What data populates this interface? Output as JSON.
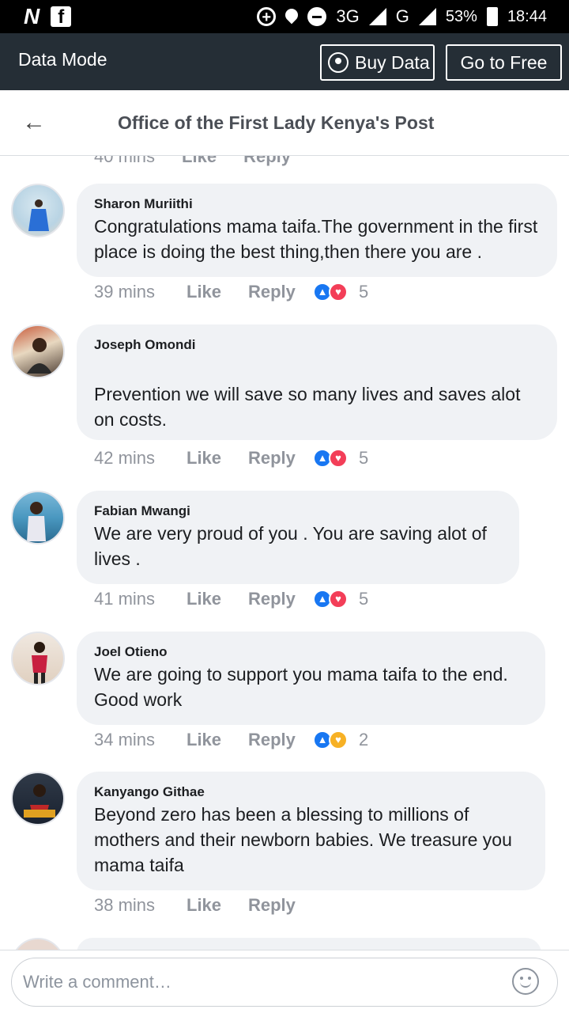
{
  "status_bar": {
    "left_icons": [
      "n-app-icon",
      "facebook-icon"
    ],
    "n_glyph": "N",
    "f_glyph": "f",
    "network": "3G",
    "network2": "G",
    "battery": "53%",
    "time": "18:44"
  },
  "data_bar": {
    "label": "Data Mode",
    "buy_button": "Buy Data",
    "free_button": "Go to Free"
  },
  "header": {
    "back_glyph": "←",
    "title": "Office of the First Lady Kenya's Post"
  },
  "partial_row": {
    "time": "40 mins",
    "like": "Like",
    "reply": "Reply"
  },
  "comments": [
    {
      "name": "Sharon Muriithi",
      "text": "Congratulations mama taifa.The government in the first place is doing the best thing,then there you are .",
      "time": "39 mins",
      "like": "Like",
      "reply": "Reply",
      "reactions": [
        "like",
        "love"
      ],
      "count": "5"
    },
    {
      "name": "Joseph Omondi",
      "text": "Prevention we will save so many lives and saves alot on costs.",
      "time": "42 mins",
      "like": "Like",
      "reply": "Reply",
      "reactions": [
        "like",
        "love"
      ],
      "count": "5"
    },
    {
      "name": "Fabian Mwangi",
      "text": "We are very proud of you . You are saving alot of lives .",
      "time": "41 mins",
      "like": "Like",
      "reply": "Reply",
      "reactions": [
        "like",
        "love"
      ],
      "count": "5"
    },
    {
      "name": "Joel Otieno",
      "text": "We are going to support you mama taifa to the end. Good work",
      "time": "34 mins",
      "like": "Like",
      "reply": "Reply",
      "reactions": [
        "like",
        "care"
      ],
      "count": "2"
    },
    {
      "name": "Kanyango Githae",
      "text": "Beyond zero has been a blessing to millions of mothers and their newborn babies. We treasure you mama taifa",
      "time": "38 mins",
      "like": "Like",
      "reply": "Reply",
      "reactions": [],
      "count": ""
    }
  ],
  "composer": {
    "placeholder": "Write a comment…"
  },
  "colors": {
    "data_bar_bg": "#252e36",
    "bubble_bg": "#f0f2f5",
    "like_blue": "#1877f2",
    "love_red": "#f33e58",
    "care_yellow": "#f7b125"
  }
}
